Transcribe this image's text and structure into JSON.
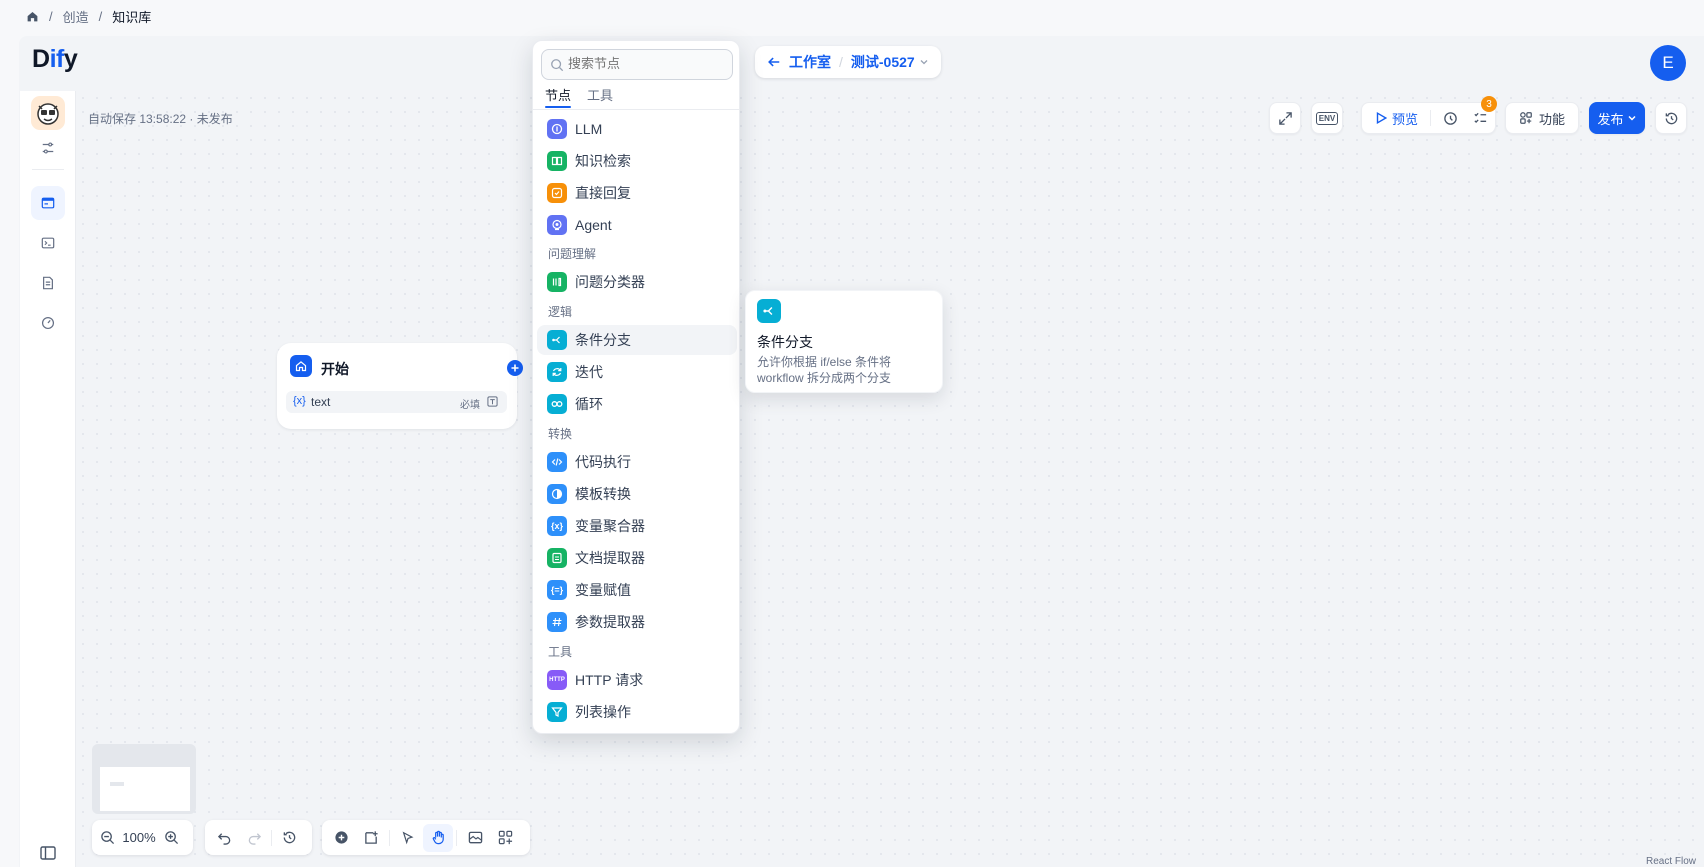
{
  "breadcrumb": {
    "items": [
      "创造",
      "知识库"
    ],
    "home_icon": "home-icon"
  },
  "app": {
    "logo_text_left": "D",
    "logo_text_mid": "if",
    "logo_text_right": "y",
    "avatar_initial": "E"
  },
  "canvas": {
    "autosave": "自动保存 13:58:22 · 未发布"
  },
  "header_pill": {
    "back_label": "工作室",
    "workflow_name": "测试-0527"
  },
  "toolbar": {
    "env_label": "ENV",
    "preview_label": "预览",
    "checklist_count": "3",
    "features_label": "功能",
    "publish_label": "发布"
  },
  "start_node": {
    "title": "开始",
    "var_prefix": "{x}",
    "var_name": "text",
    "required_label": "必填"
  },
  "picker": {
    "search_placeholder": "搜索节点",
    "tabs": [
      "节点",
      "工具"
    ],
    "items_top": [
      {
        "label": "LLM",
        "color": "#6172f3"
      },
      {
        "label": "知识检索",
        "color": "#16b364"
      },
      {
        "label": "直接回复",
        "color": "#f79009"
      },
      {
        "label": "Agent",
        "color": "#6172f3"
      }
    ],
    "group_understanding": "问题理解",
    "items_understanding": [
      {
        "label": "问题分类器",
        "color": "#16b364"
      }
    ],
    "group_logic": "逻辑",
    "items_logic": [
      {
        "label": "条件分支",
        "color": "#06aed4"
      },
      {
        "label": "迭代",
        "color": "#06aed4"
      },
      {
        "label": "循环",
        "color": "#06aed4"
      }
    ],
    "group_transform": "转换",
    "items_transform": [
      {
        "label": "代码执行",
        "color": "#2e90fa"
      },
      {
        "label": "模板转换",
        "color": "#2e90fa"
      },
      {
        "label": "变量聚合器",
        "color": "#2e90fa"
      },
      {
        "label": "文档提取器",
        "color": "#16b364"
      },
      {
        "label": "变量赋值",
        "color": "#2e90fa"
      },
      {
        "label": "参数提取器",
        "color": "#2e90fa"
      }
    ],
    "group_tools": "工具",
    "items_tools": [
      {
        "label": "HTTP 请求",
        "color": "#875bf7"
      },
      {
        "label": "列表操作",
        "color": "#06aed4"
      }
    ]
  },
  "tooltip": {
    "title": "条件分支",
    "desc_line1": "允许你根据 if/else 条件将",
    "desc_line2": "workflow 拆分成两个分支"
  },
  "zoom": {
    "level": "100%"
  },
  "footer": {
    "attribution": "React Flow"
  }
}
